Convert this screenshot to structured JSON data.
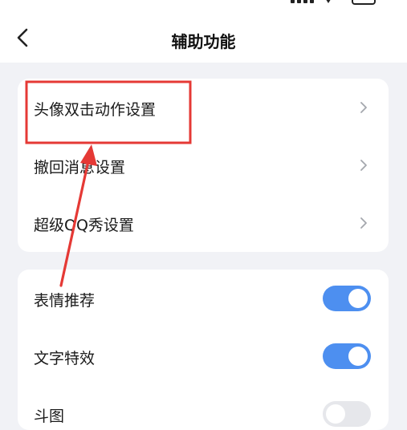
{
  "header": {
    "title": "辅助功能",
    "back_icon": "chevron-left-icon"
  },
  "section1": {
    "items": [
      {
        "label": "头像双击动作设置"
      },
      {
        "label": "撤回消息设置"
      },
      {
        "label": "超级QQ秀设置"
      }
    ]
  },
  "section2": {
    "items": [
      {
        "label": "表情推荐",
        "enabled": true
      },
      {
        "label": "文字特效",
        "enabled": true
      },
      {
        "label": "斗图",
        "enabled": false
      }
    ]
  },
  "colors": {
    "accent": "#4d8ff0",
    "highlight": "#e53935",
    "background": "#f1f2f6"
  }
}
